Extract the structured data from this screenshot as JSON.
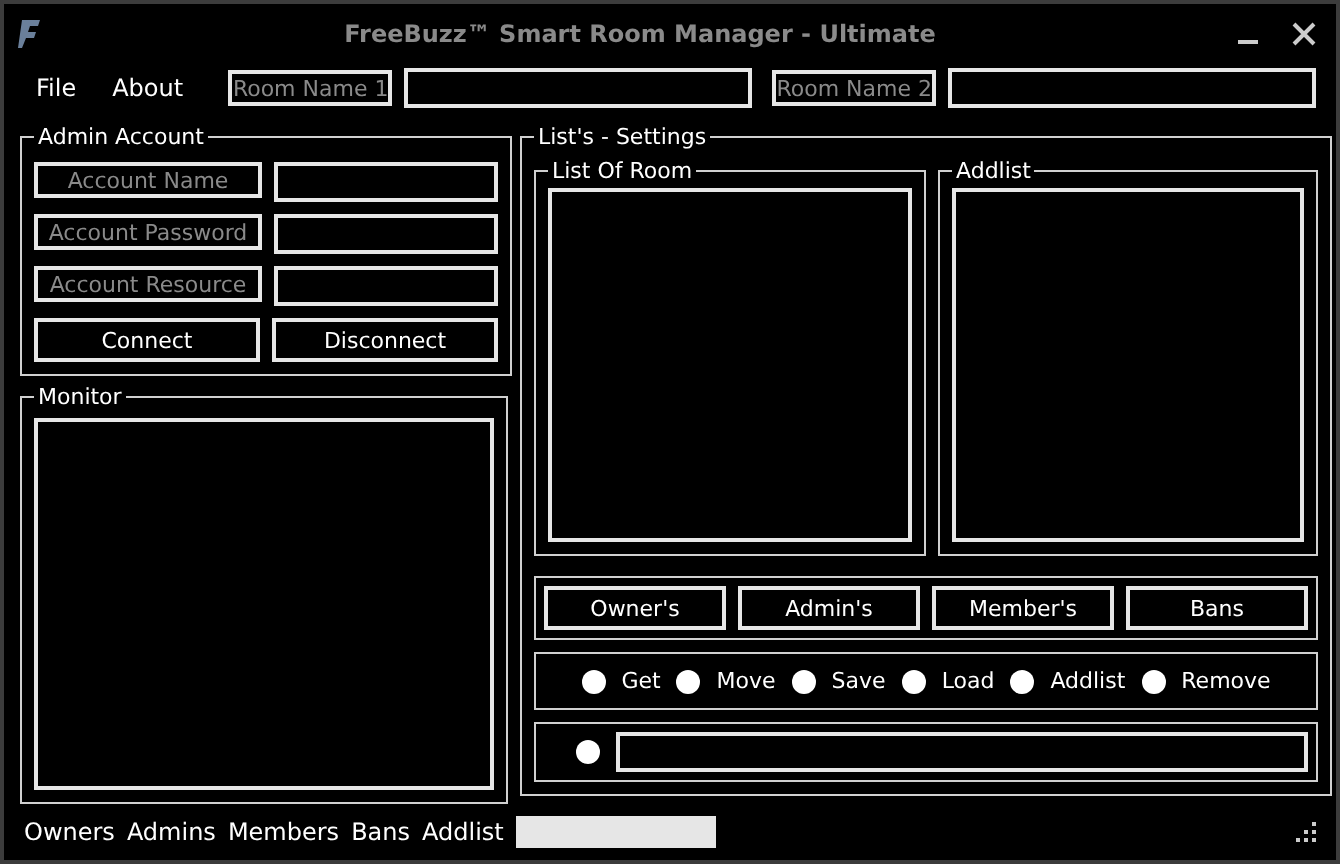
{
  "window": {
    "title": "FreeBuzz™ Smart Room Manager - Ultimate"
  },
  "menu": [
    "File",
    "About"
  ],
  "rooms": [
    {
      "label": "Room Name 1"
    },
    {
      "label": "Room Name 2"
    }
  ],
  "admin_account": {
    "title": "Admin Account",
    "fields": [
      {
        "label": "Account Name"
      },
      {
        "label": "Account Password"
      },
      {
        "label": "Account Resource"
      }
    ],
    "buttons": [
      "Connect",
      "Disconnect"
    ]
  },
  "monitor": {
    "title": "Monitor"
  },
  "lists_settings": {
    "title": "List's - Settings",
    "list_of_room": {
      "title": "List Of Room"
    },
    "addlist": {
      "title": "Addlist"
    },
    "buttons": [
      "Owner's",
      "Admin's",
      "Member's",
      "Bans"
    ],
    "actions": [
      {
        "label": "Get",
        "selected": false
      },
      {
        "label": "Move",
        "selected": false
      },
      {
        "label": "Save",
        "selected": false
      },
      {
        "label": "Load",
        "selected": false
      },
      {
        "label": "Addlist",
        "selected": false
      },
      {
        "label": "Remove",
        "selected": false
      }
    ],
    "custom": {
      "selected": false
    }
  },
  "status_bar": [
    "Owners",
    "Admins",
    "Members",
    "Bans",
    "Addlist"
  ]
}
